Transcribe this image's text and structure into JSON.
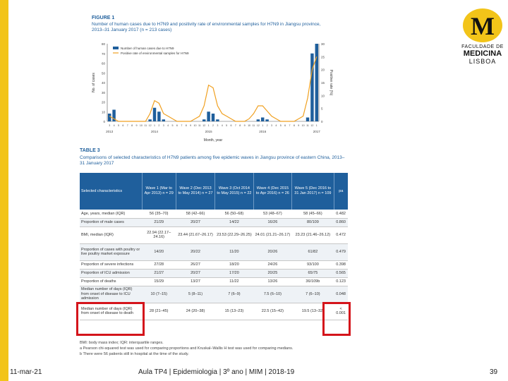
{
  "logo": {
    "line1": "FACULDADE DE",
    "line2": "MEDICINA",
    "line3": "LISBOA",
    "mark": "M"
  },
  "figure": {
    "label": "FIGURE 1",
    "caption": "Number of human cases due to H7N9 and positivity rate of environmental samples for H7N9 in Jiangsu province, 2013–31 January 2017 (n = 213 cases)"
  },
  "chart_data": {
    "type": "bar",
    "categories": [
      "2013-03",
      "2013-04",
      "2013-05",
      "2013-06",
      "2013-07",
      "2013-08",
      "2013-09",
      "2013-10",
      "2013-11",
      "2013-12",
      "2014-01",
      "2014-02",
      "2014-03",
      "2014-04",
      "2014-05",
      "2014-06",
      "2014-07",
      "2014-08",
      "2014-09",
      "2014-10",
      "2014-11",
      "2014-12",
      "2015-01",
      "2015-02",
      "2015-03",
      "2015-04",
      "2015-05",
      "2015-06",
      "2015-07",
      "2015-08",
      "2015-09",
      "2015-10",
      "2015-11",
      "2015-12",
      "2016-01",
      "2016-02",
      "2016-03",
      "2016-04",
      "2016-05",
      "2016-06",
      "2016-07",
      "2016-08",
      "2016-09",
      "2016-10",
      "2016-11",
      "2016-12",
      "2017-01"
    ],
    "series": [
      {
        "name": "Number of human cases due to H7N9",
        "values": [
          8,
          12,
          0,
          0,
          0,
          0,
          0,
          0,
          0,
          2,
          14,
          10,
          2,
          0,
          0,
          0,
          0,
          0,
          0,
          0,
          0,
          2,
          10,
          8,
          2,
          0,
          0,
          0,
          0,
          0,
          0,
          0,
          0,
          2,
          4,
          2,
          0,
          0,
          0,
          0,
          0,
          0,
          0,
          0,
          4,
          70,
          80
        ]
      },
      {
        "name": "Positive rate of environmental samples for H7N9",
        "values": [
          2,
          1,
          0,
          0,
          0,
          0,
          0,
          0,
          0,
          3,
          8,
          7,
          3,
          2,
          1,
          0,
          0,
          0,
          0,
          1,
          2,
          6,
          14,
          13,
          6,
          3,
          2,
          1,
          0,
          0,
          0,
          1,
          3,
          6,
          6,
          4,
          2,
          1,
          0,
          0,
          0,
          0,
          1,
          2,
          9,
          20,
          25
        ]
      }
    ],
    "y_left_ticks": [
      "0",
      "10",
      "20",
      "30",
      "40",
      "50",
      "60",
      "70",
      "80"
    ],
    "y_right_ticks": [
      "0",
      "5",
      "10",
      "15",
      "20",
      "25",
      "30"
    ],
    "year_labels": [
      "2013",
      "2014",
      "2015",
      "2016",
      "2017"
    ],
    "xlabel": "Month, year",
    "ylabel_left": "No. of cases",
    "ylabel_right": "Positive rate (%)",
    "ylim": [
      0,
      80
    ],
    "colors": {
      "bars": "#1f5f9c",
      "line": "#f0a020"
    },
    "legend": "top-left"
  },
  "table": {
    "label": "TABLE 3",
    "caption": "Comparisons of selected characteristics of H7N9 patients among five epidemic waves in Jiangsu province of eastern China, 2013–31 January 2017",
    "headers": [
      "Selected characteristics",
      "Wave 1 (Mar to Apr 2013) n = 29",
      "Wave 2 (Dec 2013 to May 2014) n = 27",
      "Wave 3 (Oct 2014 to May 2015) n = 22",
      "Wave 4 (Dec 2015 to Apr 2016) n = 26",
      "Wave 5 (Dec 2016 to 31 Jan 2017) n = 109",
      "pa"
    ],
    "rows": [
      [
        "Age, years, median (IQR)",
        "56 (35–70)",
        "58 (42–66)",
        "56 (50–68)",
        "53 (48–67)",
        "58 (45–66)",
        "0.482"
      ],
      [
        "Proportion of male cases",
        "21/29",
        "20/27",
        "14/22",
        "16/26",
        "80/109",
        "0.860"
      ],
      [
        "BMI, median (IQR)",
        "22.94 (22.17–24.16)",
        "23.44 (21.67–26.17)",
        "23.53 (22.29–26.25)",
        "24.01 (21.21–26.17)",
        "23.23 (21.46–26.12)",
        "0.472"
      ],
      [
        "Proportion of cases with poultry or live poultry market exposure",
        "14/20",
        "20/22",
        "11/20",
        "20/26",
        "61/82",
        "0.479"
      ],
      [
        "Proportion of severe infections",
        "27/28",
        "26/27",
        "18/20",
        "24/26",
        "93/100",
        "0.398"
      ],
      [
        "Proportion of ICU admission",
        "21/27",
        "20/27",
        "17/20",
        "20/25",
        "65/75",
        "0.565"
      ],
      [
        "Proportion of deaths",
        "15/29",
        "13/27",
        "11/22",
        "13/26",
        "36/109b",
        "0.123"
      ],
      [
        "Median number of days (IQR) from onset of disease to ICU admission",
        "10 (7–15)",
        "5 (8–11)",
        "7 (6–9)",
        "7.5 (6–10)",
        "7 (6–10)",
        "0.048"
      ],
      [
        "Median number of days (IQR) from onset of disease to death",
        "28 (21–45)",
        "24 (20–38)",
        "15 (13–23)",
        "22.5 (15–42)",
        "19.5 (13–32)",
        "< 0.001"
      ]
    ]
  },
  "footnotes": [
    "BMI: body mass index; IQR: interquartile ranges.",
    "a Pearson chi-squared test was used for comparing proportions and Kruskal–Wallis H test was used for comparing medians.",
    "b There were 56 patients still in hospital at the time of the study."
  ],
  "footer": {
    "date": "11-mar-21",
    "center": "Aula TP4 | Epidemiologia | 3º ano | MIM | 2018-19",
    "page": "39"
  }
}
